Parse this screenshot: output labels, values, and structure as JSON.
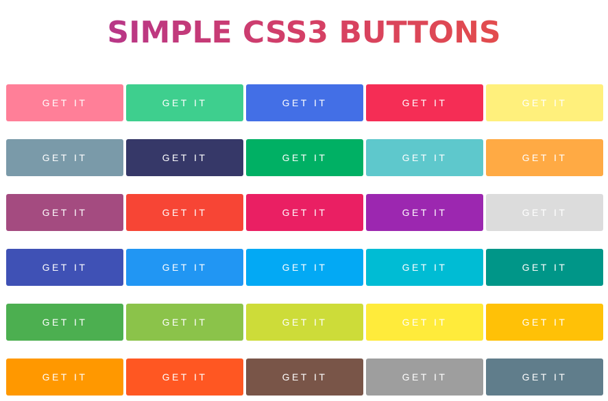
{
  "title": "SIMPLE CSS3 BUTTONS",
  "buttons": [
    {
      "label": "GET IT",
      "color": "#ff7f98"
    },
    {
      "label": "GET IT",
      "color": "#3ecf8e"
    },
    {
      "label": "GET IT",
      "color": "#436fe6"
    },
    {
      "label": "GET IT",
      "color": "#f52d55"
    },
    {
      "label": "GET IT",
      "color": "#fff07c"
    },
    {
      "label": "GET IT",
      "color": "#7a9aa9"
    },
    {
      "label": "GET IT",
      "color": "#363868"
    },
    {
      "label": "GET IT",
      "color": "#00b064"
    },
    {
      "label": "GET IT",
      "color": "#5ec8cc"
    },
    {
      "label": "GET IT",
      "color": "#ffaa44"
    },
    {
      "label": "GET IT",
      "color": "#a44b80"
    },
    {
      "label": "GET IT",
      "color": "#f74535"
    },
    {
      "label": "GET IT",
      "color": "#ea1f63"
    },
    {
      "label": "GET IT",
      "color": "#9c27b0"
    },
    {
      "label": "GET IT",
      "color": "#dcdcdc"
    },
    {
      "label": "GET IT",
      "color": "#3f51b5"
    },
    {
      "label": "GET IT",
      "color": "#2196f3"
    },
    {
      "label": "GET IT",
      "color": "#03a9f4"
    },
    {
      "label": "GET IT",
      "color": "#00bcd4"
    },
    {
      "label": "GET IT",
      "color": "#009688"
    },
    {
      "label": "GET IT",
      "color": "#4caf50"
    },
    {
      "label": "GET IT",
      "color": "#8bc34a"
    },
    {
      "label": "GET IT",
      "color": "#cddc39"
    },
    {
      "label": "GET IT",
      "color": "#ffeb3b"
    },
    {
      "label": "GET IT",
      "color": "#ffc107"
    },
    {
      "label": "GET IT",
      "color": "#ff9800"
    },
    {
      "label": "GET IT",
      "color": "#ff5722"
    },
    {
      "label": "GET IT",
      "color": "#795548"
    },
    {
      "label": "GET IT",
      "color": "#9e9e9e"
    },
    {
      "label": "GET IT",
      "color": "#607d8b"
    }
  ]
}
